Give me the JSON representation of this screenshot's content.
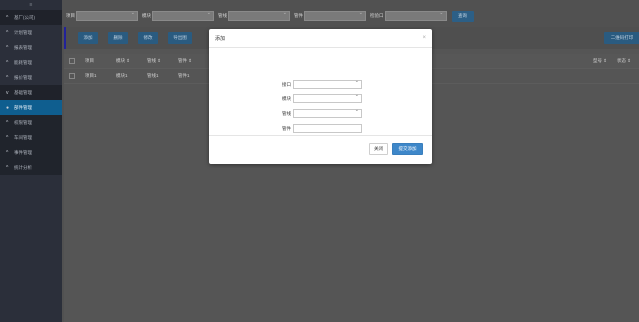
{
  "sidebar": {
    "top_icon": "≡",
    "items": [
      {
        "label": "基厂(公司)",
        "icon": "chevron-up-icon",
        "glyph": "^",
        "style": "dark"
      },
      {
        "label": "计划管理",
        "icon": "chevron-up-icon",
        "glyph": "^",
        "style": "normal"
      },
      {
        "label": "报表管理",
        "icon": "chevron-up-icon",
        "glyph": "^",
        "style": "normal"
      },
      {
        "label": "能耗管理",
        "icon": "chevron-up-icon",
        "glyph": "^",
        "style": "normal"
      },
      {
        "label": "报价管理",
        "icon": "chevron-up-icon",
        "glyph": "^",
        "style": "normal"
      },
      {
        "label": "基础管理",
        "icon": "chevron-down-icon",
        "glyph": "v",
        "style": "dark"
      },
      {
        "label": "部件管理",
        "icon": "user-icon",
        "glyph": "●",
        "style": "active"
      },
      {
        "label": "权限管理",
        "icon": "chevron-up-icon",
        "glyph": "^",
        "style": "sub"
      },
      {
        "label": "车间管理",
        "icon": "chevron-up-icon",
        "glyph": "^",
        "style": "sub"
      },
      {
        "label": "事件管理",
        "icon": "chevron-up-icon",
        "glyph": "^",
        "style": "sub"
      },
      {
        "label": "统计分析",
        "icon": "chevron-up-icon",
        "glyph": "^",
        "style": "sub"
      }
    ]
  },
  "filters": {
    "labels": [
      "项目",
      "模块",
      "管线",
      "管件",
      "检验口"
    ],
    "query_label": "查询"
  },
  "toolbar": {
    "add_label": "添加",
    "delete_label": "删除",
    "edit_label": "修改",
    "export_label": "导出图",
    "qrcode_label": "二维码打印"
  },
  "table": {
    "headers": [
      "项目",
      "模块 ⇕",
      "管线 ⇕",
      "管件 ⇕"
    ],
    "tail_headers": [
      "型号 ⇕",
      "状态 ⇕"
    ],
    "rows": [
      [
        "项目1",
        "模块1",
        "管线1",
        "管件1"
      ]
    ]
  },
  "modal": {
    "title": "添加",
    "close_glyph": "×",
    "fields": [
      {
        "label": "接口",
        "type": "select",
        "value": ""
      },
      {
        "label": "模块",
        "type": "select",
        "value": ""
      },
      {
        "label": "管线",
        "type": "select",
        "value": ""
      },
      {
        "label": "管件",
        "type": "text",
        "value": ""
      }
    ],
    "close_button": "关闭",
    "submit_button": "提交添加"
  },
  "colors": {
    "primary": "#3e87c9",
    "sidebar_bg": "#2b2f3a",
    "sidebar_active": "#0f5e8f"
  }
}
